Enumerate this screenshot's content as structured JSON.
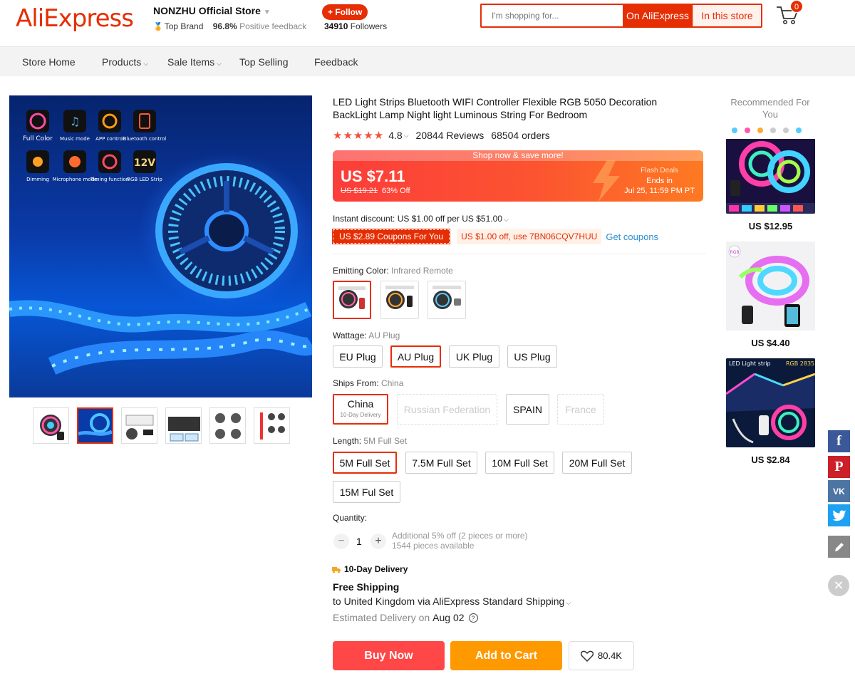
{
  "header": {
    "logo": "AliExpress",
    "store_name": "NONZHU Official Store",
    "store_badge": "Top Brand",
    "feedback_pct": "96.8%",
    "feedback_label": "Positive feedback",
    "follow_label": "+ Follow",
    "followers_count": "34910",
    "followers_label": "Followers",
    "search_placeholder": "I'm shopping for...",
    "search_on_ali": "On AliExpress",
    "search_in_store": "In this store",
    "cart_count": "0"
  },
  "nav": {
    "items": [
      "Store Home",
      "Products",
      "Sale Items",
      "Top Selling",
      "Feedback"
    ]
  },
  "product": {
    "title": "LED Light Strips Bluetooth WIFI Controller Flexible RGB 5050 Decoration BackLight Lamp Night light Luminous String For Bedroom",
    "rating": "4.8",
    "reviews": "20844 Reviews",
    "orders": "68504 orders",
    "price_banner": "Shop now & save more!",
    "price": "US $7.11",
    "old_price": "US $19.21",
    "discount": "63% Off",
    "flash_title": "Flash Deals",
    "flash_ends": "Ends in",
    "flash_date": "Jul 25, 11:59 PM PT",
    "instant_discount": "Instant discount: US $1.00 off per US $51.00",
    "coupon_red": "US $2.89 Coupons For You",
    "coupon_light": "US $1.00 off, use 7BN06CQV7HUU",
    "get_coupons": "Get coupons",
    "gallery_features": [
      "Full Color",
      "Music mode",
      "APP control",
      "Bluetooth control",
      "Dimming",
      "Microphone mode",
      "Timing function",
      "RGB LED Strip"
    ],
    "gallery_badge": "12V"
  },
  "props": {
    "color_label": "Emitting Color:",
    "color_value": "Infrared Remote",
    "wattage_label": "Wattage:",
    "wattage_value": "AU Plug",
    "wattage_options": [
      "EU Plug",
      "AU Plug",
      "UK Plug",
      "US Plug"
    ],
    "ships_label": "Ships From:",
    "ships_value": "China",
    "ships_options": [
      "China",
      "Russian Federation",
      "SPAIN",
      "France"
    ],
    "ships_china_sub": "10-Day Delivery",
    "length_label": "Length:",
    "length_value": "5M Full Set",
    "length_options": [
      "5M Full Set",
      "7.5M Full Set",
      "10M Full Set",
      "20M Full Set",
      "15M Ful Set"
    ]
  },
  "quantity": {
    "label": "Quantity:",
    "value": "1",
    "minus": "−",
    "plus": "+",
    "note1": "Additional 5% off (2 pieces or more)",
    "note2": "1544 pieces available"
  },
  "shipping": {
    "tag": "10-Day Delivery",
    "free": "Free Shipping",
    "to": "to United Kingdom via AliExpress Standard Shipping",
    "est_label": "Estimated Delivery on",
    "est_date": "Aug 02"
  },
  "actions": {
    "buy_now": "Buy Now",
    "add_to_cart": "Add to Cart",
    "wishlist_count": "80.4K"
  },
  "recommended": {
    "title": "Recommended For You",
    "items": [
      {
        "price": "US $12.95"
      },
      {
        "price": "US $4.40",
        "badge": "RGB"
      },
      {
        "price": "US $2.84",
        "label1": "LED Light strip",
        "label2": "RGB 2835"
      }
    ]
  },
  "social": {
    "icons": [
      "facebook-icon",
      "pinterest-icon",
      "vk-icon",
      "twitter-icon",
      "edit-icon"
    ],
    "colors": [
      "#3b5998",
      "#cb2027",
      "#4c75a3",
      "#1da1f2",
      "#888888"
    ]
  },
  "colors": {
    "accent": "#e62e04",
    "buy_now": "#ff4747",
    "add_to_cart": "#ff9900",
    "link": "#2b8bd0"
  }
}
